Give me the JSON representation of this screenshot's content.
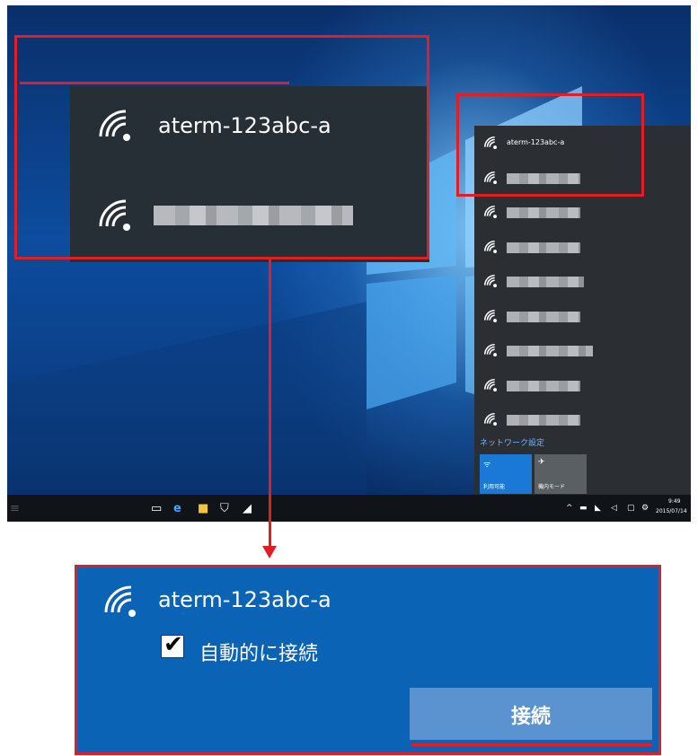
{
  "zoom": {
    "network_name": "aterm-123abc-a"
  },
  "flyout": {
    "networks": [
      {
        "ssid": "aterm-123abc-a"
      },
      {
        "ssid": ""
      },
      {
        "ssid": ""
      },
      {
        "ssid": ""
      },
      {
        "ssid": ""
      },
      {
        "ssid": ""
      },
      {
        "ssid": ""
      },
      {
        "ssid": ""
      },
      {
        "ssid": ""
      }
    ],
    "settings_link": "ネットワーク設定",
    "tiles": [
      {
        "label": "利用可能",
        "icon": "wifi-icon",
        "color": "#1a79d6"
      },
      {
        "label": "機内モード",
        "icon": "airplane-icon",
        "color": "#5a5f64"
      }
    ]
  },
  "taskbar": {
    "clock_time": "9:49",
    "clock_date": "2015/07/14"
  },
  "connect": {
    "network_name": "aterm-123abc-a",
    "auto_connect_label": "自動的に接続",
    "auto_connect_checked": true,
    "connect_button_label": "接続"
  },
  "colors": {
    "highlight": "#e01e24",
    "panel_blue": "#0b63b5",
    "button_blue": "#5b93d0"
  }
}
